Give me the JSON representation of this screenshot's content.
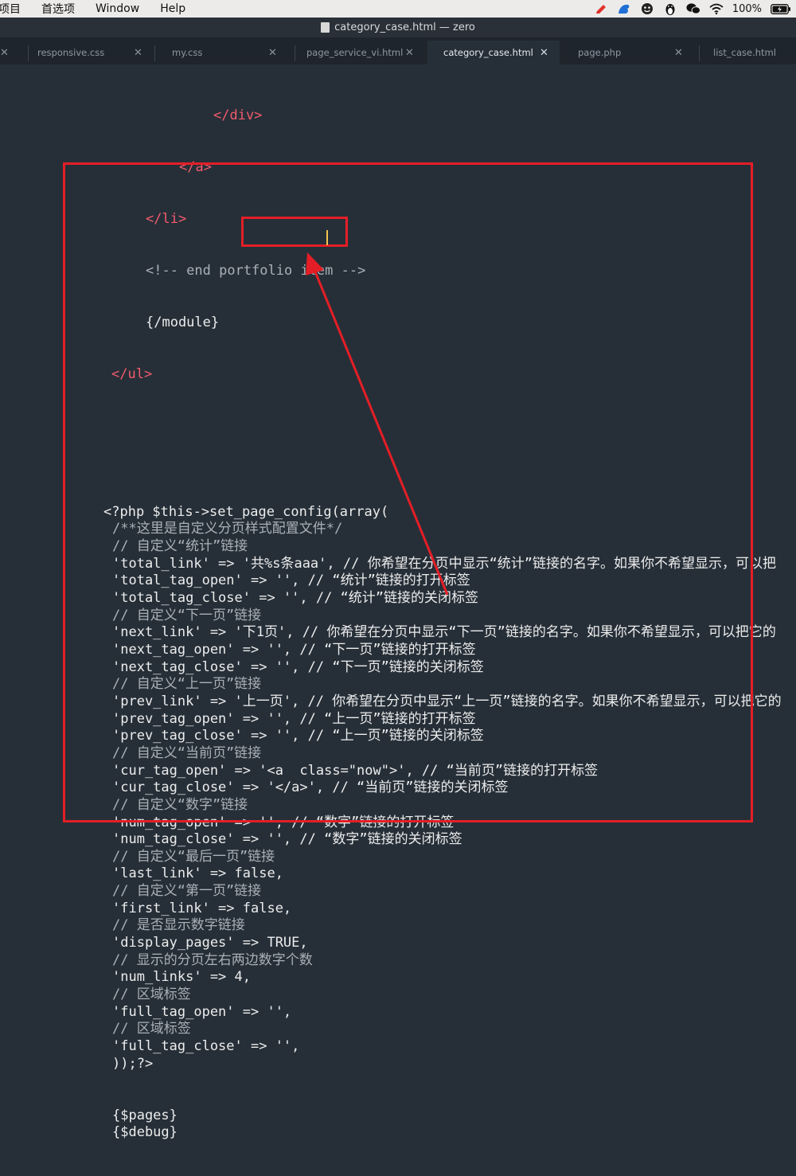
{
  "menubar": {
    "items": [
      "项目",
      "首选项",
      "Window",
      "Help"
    ],
    "battery": "100%",
    "status_icons": [
      "pencil-icon",
      "bird-icon",
      "face-icon",
      "penguin-icon",
      "wechat-icon",
      "wifi-icon",
      "battery-icon"
    ]
  },
  "window": {
    "title": "category_case.html — zero"
  },
  "tabs": [
    {
      "label": "responsive.css",
      "active": false
    },
    {
      "label": "my.css",
      "active": false
    },
    {
      "label": "page_service_vi.html",
      "active": false
    },
    {
      "label": "category_case.html",
      "active": true
    },
    {
      "label": "page.php",
      "active": false
    },
    {
      "label": "list_case.html",
      "active": false
    }
  ],
  "code": {
    "html_lines": [
      "</div>",
      "</a>",
      "</li>",
      "<!-- end portfolio item -->",
      "{/module}",
      "</ul>"
    ],
    "php_lines": [
      "<?php $this->set_page_config(array(",
      "/**这里是自定义分页样式配置文件*/",
      "// 自定义“统计”链接",
      "'total_link' => '共%s条aaa', // 你希望在分页中显示“统计”链接的名字。如果你不希望显示，可以把",
      "'total_tag_open' => '', // “统计”链接的打开标签",
      "'total_tag_close' => '', // “统计”链接的关闭标签",
      "// 自定义“下一页”链接",
      "'next_link' => '下1页', // 你希望在分页中显示“下一页”链接的名字。如果你不希望显示，可以把它的",
      "'next_tag_open' => '', // “下一页”链接的打开标签",
      "'next_tag_close' => '', // “下一页”链接的关闭标签",
      "// 自定义“上一页”链接",
      "'prev_link' => '上一页', // 你希望在分页中显示“上一页”链接的名字。如果你不希望显示，可以把它的",
      "'prev_tag_open' => '', // “上一页”链接的打开标签",
      "'prev_tag_close' => '', // “上一页”链接的关闭标签",
      "// 自定义“当前页”链接",
      "'cur_tag_open' => '<a  class=\"now\">', // “当前页”链接的打开标签",
      "'cur_tag_close' => '</a>', // “当前页”链接的关闭标签",
      "// 自定义“数字”链接",
      "'num_tag_open' => '', // “数字”链接的打开标签",
      "'num_tag_close' => '', // “数字”链接的关闭标签",
      "// 自定义“最后一页”链接",
      "'last_link' => false,",
      "// 自定义“第一页”链接",
      "'first_link' => false,",
      "// 是否显示数字链接",
      "'display_pages' => TRUE,",
      "// 显示的分页左右两边数字个数",
      "'num_links' => 4,",
      "// 区域标签",
      "'full_tag_open' => '',",
      "// 区域标签",
      "'full_tag_close' => '',",
      "));?>",
      "",
      "",
      "{$pages}",
      "{$debug}"
    ]
  },
  "colors": {
    "editor_bg": "#262f38",
    "annotation_red": "#e41e26",
    "html_tag": "#f25a6d",
    "comment": "#aab0b6"
  }
}
